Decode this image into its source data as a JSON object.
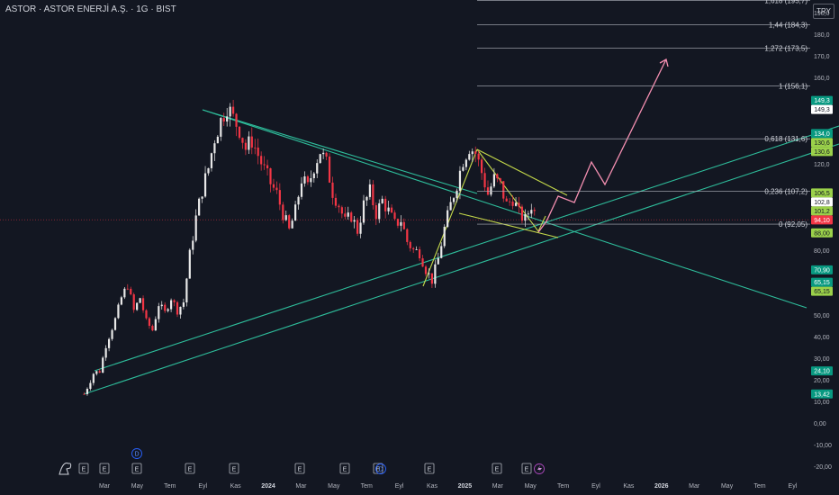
{
  "header": {
    "title": "ASTOR · ASTOR ENERJİ A.Ş. · 1G · BIST",
    "currency": "TRY"
  },
  "chart_data": {
    "type": "candlestick",
    "symbol": "ASTOR",
    "ylim": [
      -20,
      200
    ],
    "y_ticks": [
      "190,0",
      "180,0",
      "170,0",
      "160,0",
      "120,0",
      "80,00",
      "50,00",
      "40,00",
      "30,00",
      "20,00",
      "10,00",
      "0,00",
      "-10,00",
      "-20,00"
    ],
    "x_ticks": [
      "Mar",
      "May",
      "Tem",
      "Eyl",
      "Kas",
      "2024",
      "Mar",
      "May",
      "Tem",
      "Eyl",
      "Kas",
      "2025",
      "Mar",
      "May",
      "Tem",
      "Eyl",
      "Kas",
      "2026",
      "Mar",
      "May",
      "Tem",
      "Eyl"
    ],
    "close_series": [
      [
        0,
        13.4
      ],
      [
        3,
        23
      ],
      [
        5,
        24.1
      ],
      [
        7,
        36
      ],
      [
        10,
        48
      ],
      [
        12,
        58
      ],
      [
        14,
        64
      ],
      [
        16,
        52
      ],
      [
        18,
        58
      ],
      [
        20,
        47
      ],
      [
        22,
        43
      ],
      [
        24,
        55
      ],
      [
        26,
        51
      ],
      [
        28,
        58
      ],
      [
        30,
        52
      ],
      [
        32,
        56
      ],
      [
        34,
        78
      ],
      [
        36,
        95
      ],
      [
        38,
        108
      ],
      [
        40,
        118
      ],
      [
        42,
        132
      ],
      [
        44,
        140
      ],
      [
        46,
        147
      ],
      [
        48,
        141
      ],
      [
        50,
        136
      ],
      [
        52,
        127
      ],
      [
        54,
        131
      ],
      [
        56,
        124
      ],
      [
        58,
        117
      ],
      [
        60,
        111
      ],
      [
        62,
        106
      ],
      [
        64,
        97
      ],
      [
        66,
        89
      ],
      [
        68,
        98
      ],
      [
        70,
        113
      ],
      [
        72,
        109
      ],
      [
        74,
        119
      ],
      [
        76,
        126
      ],
      [
        78,
        120
      ],
      [
        80,
        107
      ],
      [
        82,
        101
      ],
      [
        84,
        93
      ],
      [
        86,
        96
      ],
      [
        88,
        89
      ],
      [
        90,
        101
      ],
      [
        92,
        107
      ],
      [
        94,
        97
      ],
      [
        96,
        103
      ],
      [
        98,
        98
      ],
      [
        100,
        92
      ],
      [
        102,
        94
      ],
      [
        104,
        84
      ],
      [
        106,
        80
      ],
      [
        108,
        79
      ],
      [
        110,
        71
      ],
      [
        112,
        66
      ],
      [
        114,
        76
      ],
      [
        116,
        90
      ],
      [
        118,
        101
      ],
      [
        120,
        111
      ],
      [
        122,
        122
      ],
      [
        124,
        128
      ],
      [
        126,
        125
      ],
      [
        128,
        116
      ],
      [
        130,
        106
      ],
      [
        132,
        113
      ],
      [
        134,
        110
      ],
      [
        136,
        101
      ],
      [
        138,
        104
      ],
      [
        140,
        97
      ],
      [
        142,
        94
      ],
      [
        144,
        101
      ],
      [
        146,
        94.1
      ]
    ],
    "fibonacci": [
      {
        "label": "1,618 (195,7)",
        "value": 195.7
      },
      {
        "label": "1,44 (184,3)",
        "value": 184.3
      },
      {
        "label": "1,272 (173,5)",
        "value": 173.5
      },
      {
        "label": "1 (156,1)",
        "value": 156.1
      },
      {
        "label": "0,618 (131,6)",
        "value": 131.6
      },
      {
        "label": "0,236 (107,2)",
        "value": 107.2
      },
      {
        "label": "0 (92,05)",
        "value": 92.05
      }
    ],
    "price_badges": [
      {
        "label": "149,3",
        "value": 149.3,
        "color": "#089981",
        "text": "#ffffff"
      },
      {
        "label": "149,3",
        "value": 149.3,
        "color": "#ffffff",
        "text": "#131722"
      },
      {
        "label": "134,0",
        "value": 134.0,
        "color": "#089981",
        "text": "#ffffff"
      },
      {
        "label": "130,6",
        "value": 130.6,
        "color": "#9bd14a",
        "text": "#131722"
      },
      {
        "label": "130,6",
        "value": 130.6,
        "color": "#9bd14a",
        "text": "#131722"
      },
      {
        "label": "106,5",
        "value": 106.5,
        "color": "#9bd14a",
        "text": "#131722"
      },
      {
        "label": "102,8",
        "value": 102.8,
        "color": "#ffffff",
        "text": "#131722"
      },
      {
        "label": "101,2",
        "value": 101.2,
        "color": "#9bd14a",
        "text": "#131722"
      },
      {
        "label": "94,10",
        "value": 94.1,
        "color": "#f23645",
        "text": "#ffffff"
      },
      {
        "label": "88,00",
        "value": 88.0,
        "color": "#9bd14a",
        "text": "#131722"
      },
      {
        "label": "70,90",
        "value": 70.9,
        "color": "#089981",
        "text": "#ffffff"
      },
      {
        "label": "65,15",
        "value": 65.15,
        "color": "#089981",
        "text": "#ffffff"
      },
      {
        "label": "65,15",
        "value": 65.15,
        "color": "#9bd14a",
        "text": "#131722"
      },
      {
        "label": "24,10",
        "value": 24.1,
        "color": "#089981",
        "text": "#ffffff"
      },
      {
        "label": "13,42",
        "value": 13.42,
        "color": "#089981",
        "text": "#ffffff"
      }
    ],
    "current_price": 94.1,
    "event_markers": [
      "E",
      "E",
      "E",
      "E",
      "E",
      "E",
      "E",
      "E",
      "E",
      "E",
      "E"
    ],
    "dividend_markers": [
      "D",
      "D"
    ],
    "colors": {
      "background": "#131722",
      "up": "#e8e8e8",
      "down": "#f23645",
      "trend": "#2ebd9b",
      "wedge": "#c5d94a",
      "projection": "#f48fb1",
      "fib": "#b2b5be"
    },
    "grid": false
  }
}
